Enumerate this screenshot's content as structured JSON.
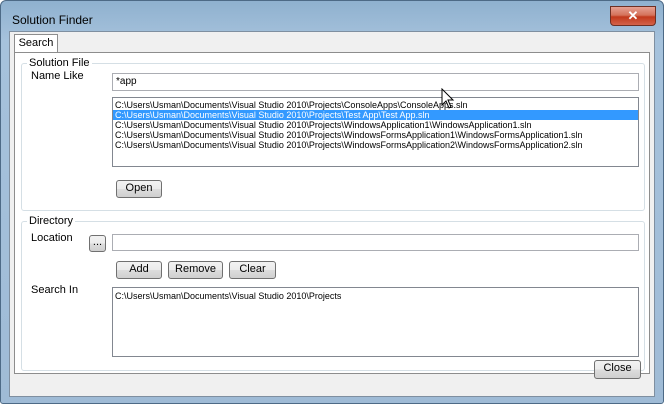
{
  "window": {
    "title": "Solution Finder",
    "close_glyph": "✕"
  },
  "tabs": [
    {
      "label": "Search"
    }
  ],
  "solution_file": {
    "group_title": "Solution File",
    "name_like_label": "Name Like",
    "name_like_value": "*app",
    "results": [
      {
        "path": "C:\\Users\\Usman\\Documents\\Visual Studio 2010\\Projects\\ConsoleApps\\ConsoleApps.sln",
        "selected": false
      },
      {
        "path": "C:\\Users\\Usman\\Documents\\Visual Studio 2010\\Projects\\Test App\\Test App.sln",
        "selected": true
      },
      {
        "path": "C:\\Users\\Usman\\Documents\\Visual Studio 2010\\Projects\\WindowsApplication1\\WindowsApplication1.sln",
        "selected": false
      },
      {
        "path": "C:\\Users\\Usman\\Documents\\Visual Studio 2010\\Projects\\WindowsFormsApplication1\\WindowsFormsApplication1.sln",
        "selected": false
      },
      {
        "path": "C:\\Users\\Usman\\Documents\\Visual Studio 2010\\Projects\\WindowsFormsApplication2\\WindowsFormsApplication2.sln",
        "selected": false
      }
    ],
    "open_label": "Open"
  },
  "directory": {
    "group_title": "Directory",
    "location_label": "Location",
    "browse_label": "...",
    "location_value": "",
    "add_label": "Add",
    "remove_label": "Remove",
    "clear_label": "Clear",
    "search_in_label": "Search In",
    "search_in_items": [
      "C:\\Users\\Usman\\Documents\\Visual Studio 2010\\Projects"
    ]
  },
  "footer": {
    "close_label": "Close"
  },
  "colors": {
    "selection": "#3399ff",
    "title_close": "#c2391c"
  },
  "icons": {
    "cursor": "mouse-pointer-icon"
  }
}
